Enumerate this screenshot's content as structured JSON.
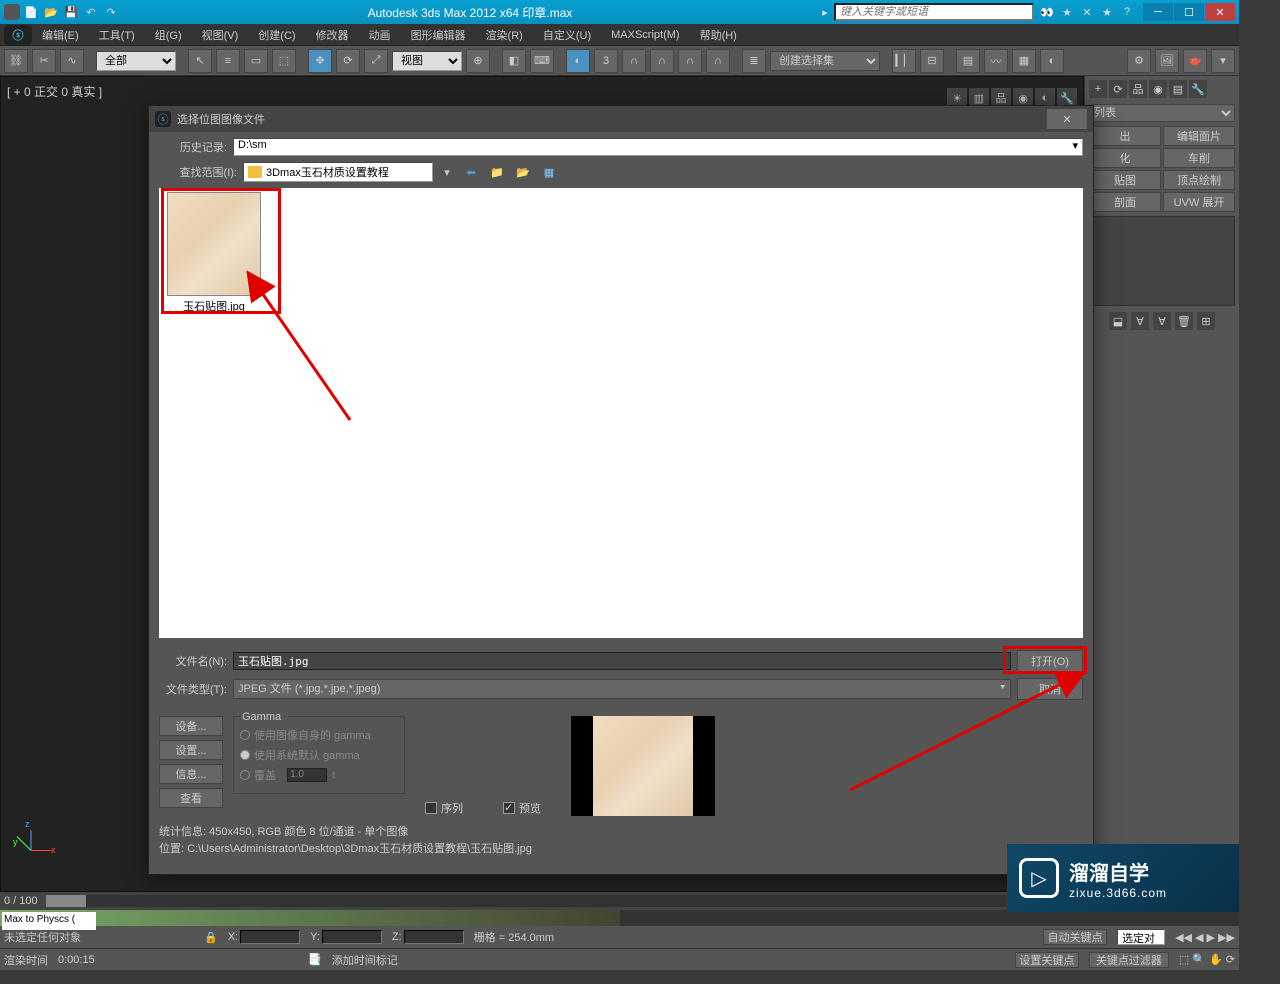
{
  "titlebar": {
    "app_title": "Autodesk 3ds Max  2012  x64     印章.max",
    "search_placeholder": "键入关键字或短语",
    "min": "─",
    "max": "☐",
    "close": "✕"
  },
  "menubar": {
    "items": [
      "编辑(E)",
      "工具(T)",
      "组(G)",
      "视图(V)",
      "创建(C)",
      "修改器",
      "动画",
      "图形编辑器",
      "渲染(R)",
      "自定义(U)",
      "MAXScript(M)",
      "帮助(H)"
    ]
  },
  "toolbar": {
    "selectAll": "全部",
    "view": "视图",
    "createSet": "创建选择集"
  },
  "viewport": {
    "label": "[ + 0 正交 0 真实 ]"
  },
  "rightpanel": {
    "list_label": "列表",
    "buttons": [
      "出",
      "编辑面片",
      "化",
      "车削",
      "贴图",
      "顶点绘制",
      "剖面",
      "UVW 展开"
    ]
  },
  "dialog": {
    "title": "选择位图图像文件",
    "history_label": "历史记录:",
    "history_value": "D:\\sm",
    "lookin_label": "查找范围(I):",
    "lookin_value": "3Dmax玉石材质设置教程",
    "thumb_name": "玉石贴图.jpg",
    "filename_label": "文件名(N):",
    "filename_value": "玉石贴图.jpg",
    "filetype_label": "文件类型(T):",
    "filetype_value": "JPEG 文件 (*.jpg,*.jpe,*.jpeg)",
    "open_btn": "打开(O)",
    "cancel_btn": "取消",
    "side_btns": [
      "设备...",
      "设置...",
      "信息...",
      "查看"
    ],
    "gamma_title": "Gamma",
    "gamma_opts": [
      "使用图像自身的 gamma",
      "使用系统默认 gamma",
      "覆盖"
    ],
    "gamma_override": "1.0",
    "sequence": "序列",
    "preview": "预览",
    "stats_label": "统计信息:",
    "stats_value": "450x450, RGB 颜色 8 位/通道 - 单个图像",
    "loc_label": "位置:",
    "loc_value": "C:\\Users\\Administrator\\Desktop\\3Dmax玉石材质设置教程\\玉石贴图.jpg"
  },
  "timeline": {
    "pos": "0 / 100"
  },
  "status": {
    "none_selected": "未选定任何对象",
    "render_time_label": "渲染时间",
    "render_time": "0:00:15",
    "x_label": "X:",
    "y_label": "Y:",
    "z_label": "Z:",
    "grid": "栅格 = 254.0mm",
    "auto_key": "自动关键点",
    "set_key": "设置关键点",
    "selected_obj": "选定对",
    "key_filter": "关键点过滤器",
    "add_time_tag": "添加时间标记"
  },
  "maxscript": "Max to Physcs (",
  "watermark": {
    "line1": "溜溜自学",
    "line2": "zixue.3d66.com"
  }
}
